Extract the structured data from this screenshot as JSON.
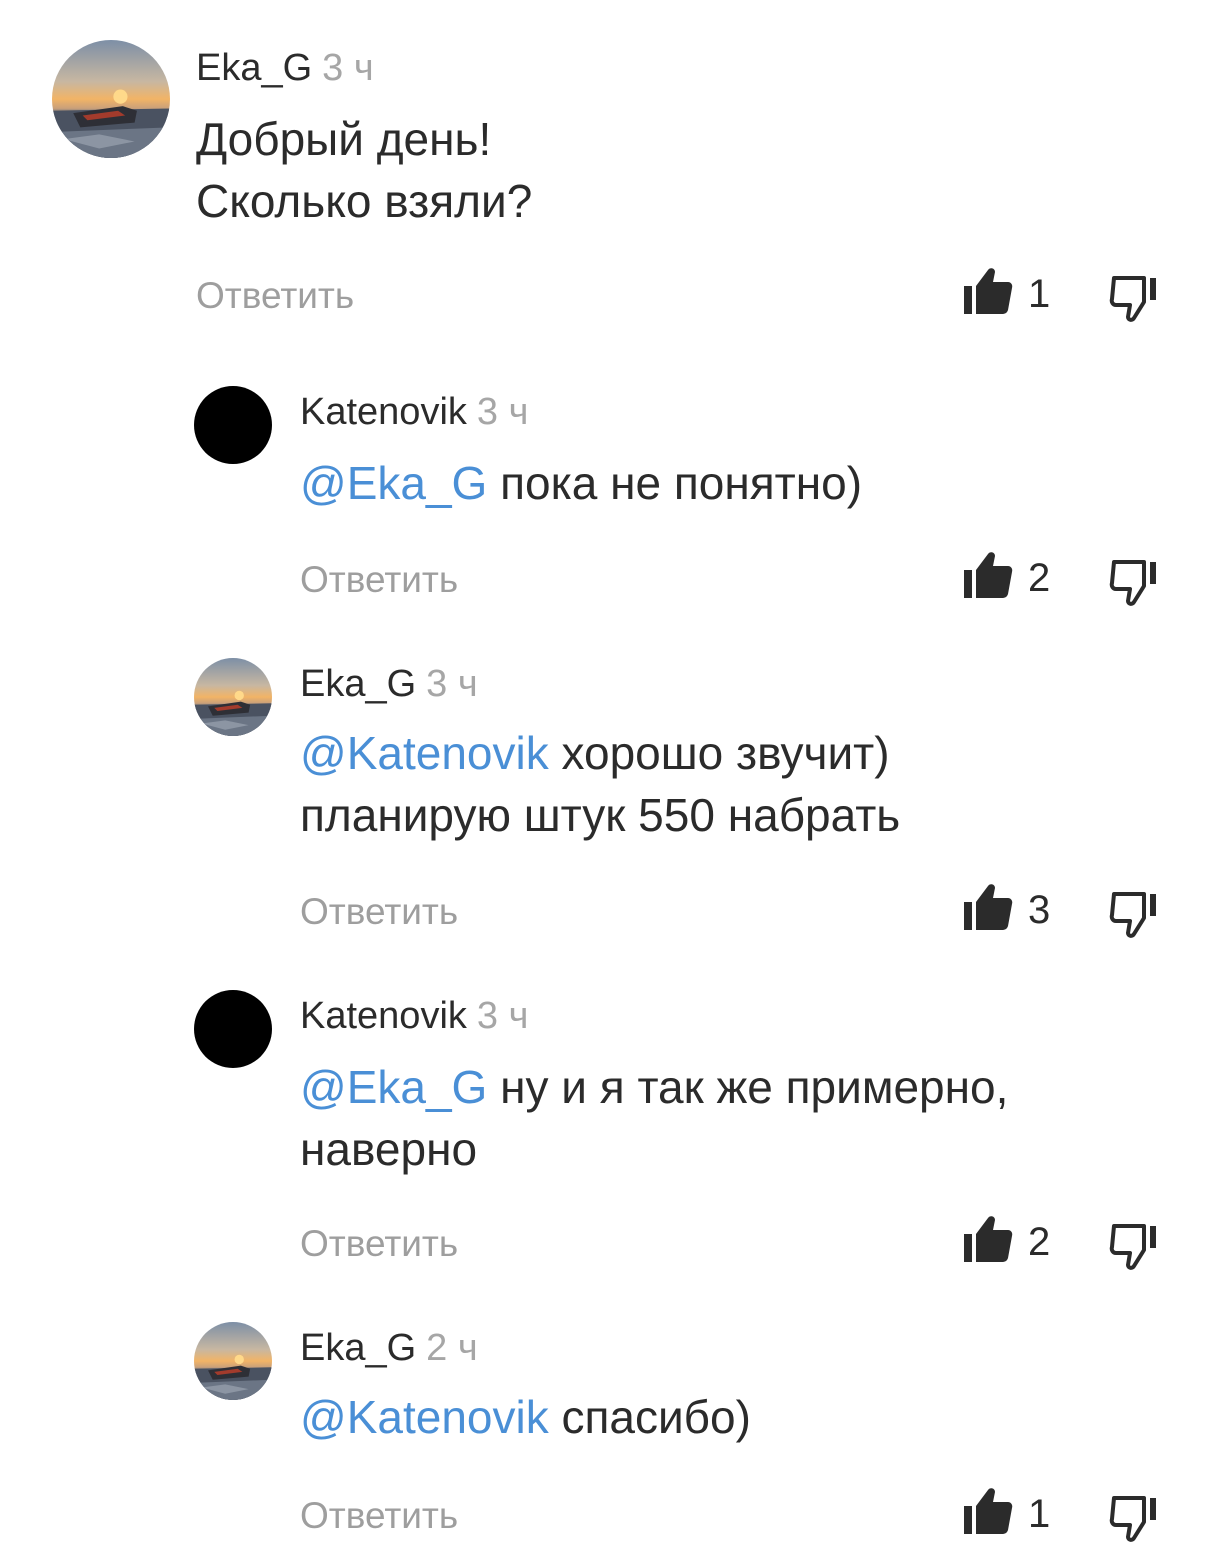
{
  "comments": [
    {
      "username": "Eka_G",
      "time": "3 ч",
      "mention": "",
      "text_line1": "Добрый день!",
      "text_line2": "Сколько взяли?",
      "reply_label": "Ответить",
      "likes": "1"
    },
    {
      "username": "Katenovik",
      "time": "3 ч",
      "mention": "@Eka_G",
      "text_line1": " пока не понятно)",
      "text_line2": "",
      "reply_label": "Ответить",
      "likes": "2"
    },
    {
      "username": "Eka_G",
      "time": "3 ч",
      "mention": "@Katenovik",
      "text_line1": " хорошо звучит)",
      "text_line2": "планирую штук 550 набрать",
      "reply_label": "Ответить",
      "likes": "3"
    },
    {
      "username": "Katenovik",
      "time": "3 ч",
      "mention": "@Eka_G",
      "text_line1": " ну и я так же примерно,",
      "text_line2": "наверно",
      "reply_label": "Ответить",
      "likes": "2"
    },
    {
      "username": "Eka_G",
      "time": "2 ч",
      "mention": "@Katenovik",
      "text_line1": " спасибо)",
      "text_line2": "",
      "reply_label": "Ответить",
      "likes": "1"
    }
  ],
  "icons": {
    "like": "thumbs-up-icon",
    "dislike": "thumbs-down-icon"
  },
  "colors": {
    "mention": "#4a8fd6",
    "muted": "#a6a6a6",
    "text": "#2b2b2b"
  }
}
